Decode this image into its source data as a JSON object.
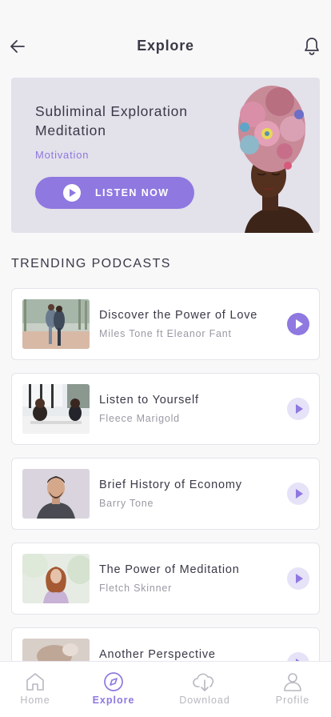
{
  "header": {
    "title": "Explore"
  },
  "hero": {
    "title": "Subliminal Exploration Meditation",
    "category": "Motivation",
    "button_label": "LISTEN NOW"
  },
  "section_title": "TRENDING PODCASTS",
  "podcasts": [
    {
      "title": "Discover the Power of Love",
      "author": "Miles Tone ft Eleanor Fant",
      "playing": true
    },
    {
      "title": "Listen to Yourself",
      "author": "Fleece Marigold",
      "playing": false
    },
    {
      "title": "Brief History of Economy",
      "author": "Barry Tone",
      "playing": false
    },
    {
      "title": "The Power of Meditation",
      "author": "Fletch Skinner",
      "playing": false
    },
    {
      "title": "Another Perspective",
      "author": "",
      "playing": false
    }
  ],
  "tabs": [
    {
      "label": "Home",
      "icon": "home-icon",
      "active": false
    },
    {
      "label": "Explore",
      "icon": "explore-icon",
      "active": true
    },
    {
      "label": "Download",
      "icon": "download-icon",
      "active": false
    },
    {
      "label": "Profile",
      "icon": "profile-icon",
      "active": false
    }
  ],
  "colors": {
    "accent": "#8f78e0",
    "accent_light": "#e6e2f7",
    "background": "#f8f8f9",
    "hero_bg": "#e3e1ea"
  }
}
